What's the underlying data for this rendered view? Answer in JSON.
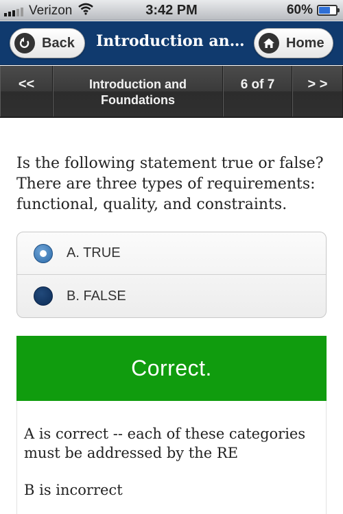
{
  "status_bar": {
    "carrier": "Verizon",
    "time": "3:42 PM",
    "battery_percent": "60%",
    "battery_level": 0.6,
    "icons": [
      "signal-icon",
      "wifi-icon",
      "battery-icon"
    ]
  },
  "header": {
    "back_label": "Back",
    "title": "Introduction and...",
    "home_label": "Home",
    "colors": {
      "background": "#103a6e"
    }
  },
  "pager": {
    "prev_label": "<<",
    "title": "Introduction and Foundations",
    "count": "6 of 7",
    "next_label": "> >"
  },
  "question": {
    "text": "Is the following statement true or false? There are three types of requirements: functional, quality, and constraints.",
    "options": [
      {
        "label": "A. TRUE",
        "selected": true
      },
      {
        "label": "B. FALSE",
        "selected": false
      }
    ]
  },
  "result": {
    "label": "Correct.",
    "color": "#109c0e"
  },
  "feedback": {
    "lines": [
      "A is correct -- each of these categories must be addressed by the RE",
      "B is incorrect"
    ]
  }
}
